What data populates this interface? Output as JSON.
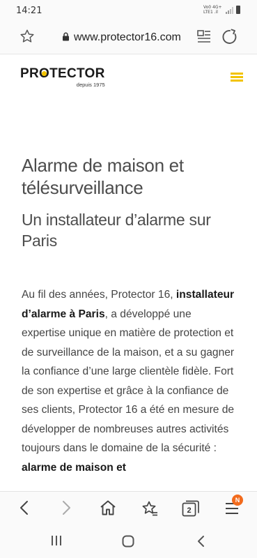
{
  "status_bar": {
    "time": "14:21",
    "network_line1": "Vo0 4G+",
    "network_line2": "LTE1 .il"
  },
  "browser": {
    "url": "www.protector16.com",
    "tab_count": "2",
    "menu_badge": "N"
  },
  "site": {
    "logo_text_left": "PR",
    "logo_text_o": "O",
    "logo_text_right": "TECTOR",
    "logo_tagline": "depuis 1975",
    "accent_color": "#f2c300"
  },
  "content": {
    "title": "Alarme de maison et télésurveillance",
    "subtitle": "Un installateur d’alarme sur Paris",
    "paragraph": {
      "part1": "Au fil des années, Protector 16, ",
      "bold1": "installateur d’alarme à Paris",
      "part2": ", a développé une expertise unique en matière de protection et de surveillance de la maison, et a su gagner la confiance d’une large clientèle fidèle. Fort de son expertise et grâce à la confiance de ses clients, Protector 16 a été en mesure de développer de nombreuses autres activités toujours dans le domaine de la sécurité : ",
      "bold2": "alarme de maison et"
    }
  }
}
